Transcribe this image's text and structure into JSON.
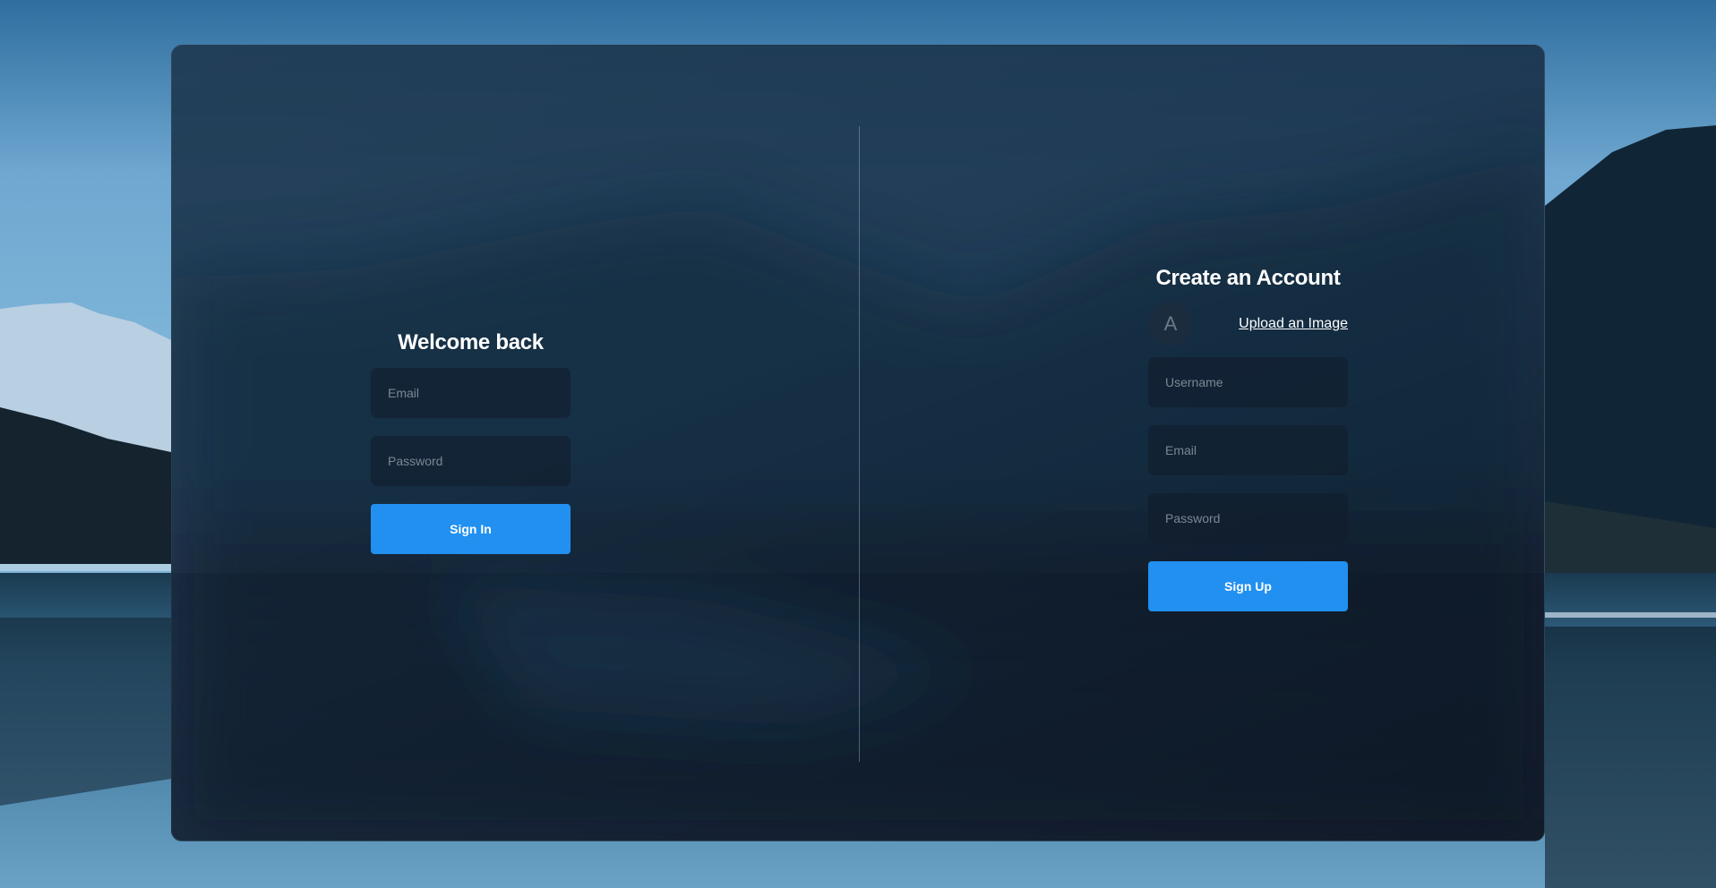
{
  "signin": {
    "title": "Welcome back",
    "email_placeholder": "Email",
    "password_placeholder": "Password",
    "button_label": "Sign In"
  },
  "signup": {
    "title": "Create an Account",
    "avatar_letter": "A",
    "upload_label": "Upload an Image",
    "username_placeholder": "Username",
    "email_placeholder": "Email",
    "password_placeholder": "Password",
    "button_label": "Sign Up"
  },
  "colors": {
    "accent": "#2190f0",
    "card": "#1b344d",
    "field": "#111b2a"
  }
}
